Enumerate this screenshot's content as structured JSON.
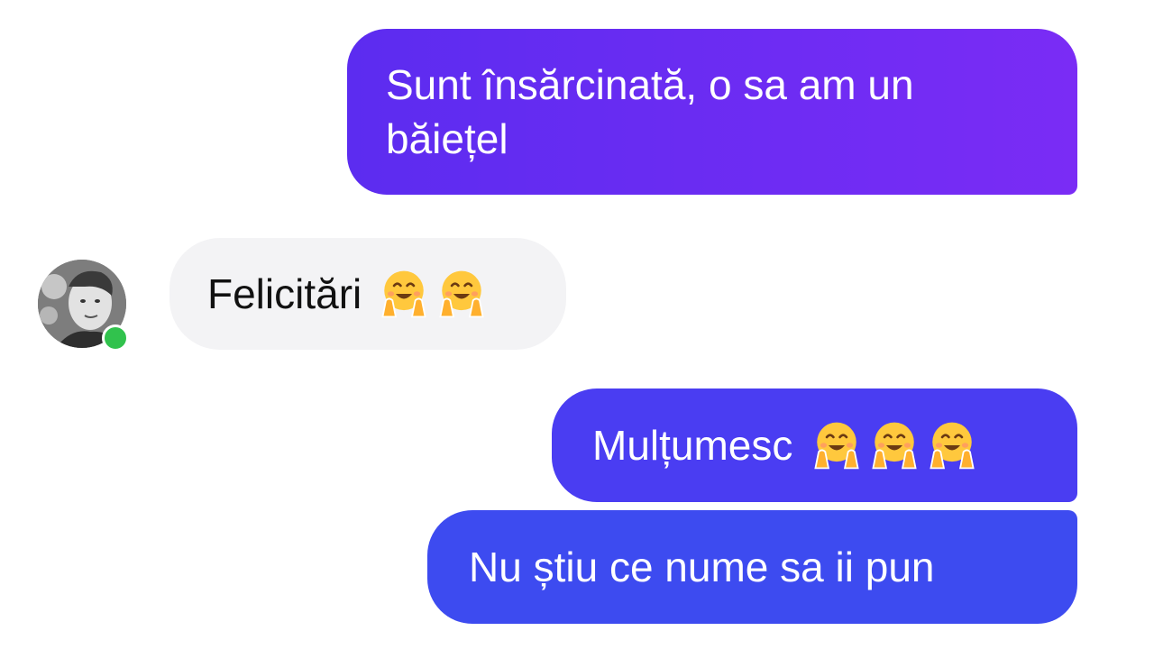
{
  "messages": {
    "m1": {
      "text": "Sunt însărcinată, o sa am un băiețel"
    },
    "m2": {
      "text": "Felicitări",
      "emoji": "hugging-face",
      "emoji_count": 2
    },
    "m3": {
      "text": "Mulțumesc",
      "emoji": "hugging-face",
      "emoji_count": 3
    },
    "m4": {
      "text": "Nu știu ce nume sa ii pun"
    }
  },
  "contact": {
    "status": "online"
  },
  "colors": {
    "outgoing_top": "#6a2cf3",
    "outgoing_mid": "#4a3df2",
    "outgoing_bottom": "#3d4bf0",
    "incoming": "#f3f3f5",
    "online": "#31c24d"
  }
}
